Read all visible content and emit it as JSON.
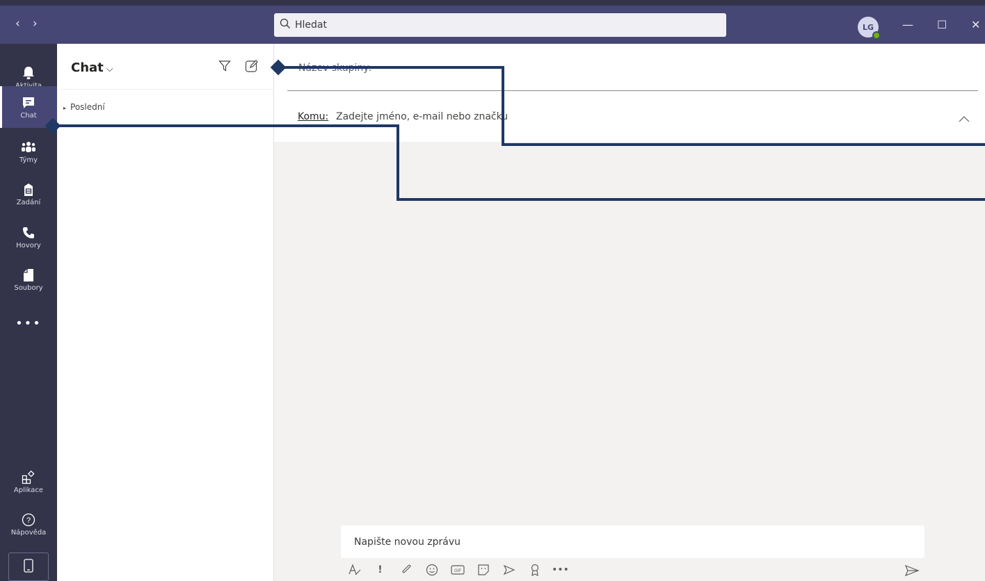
{
  "titlebar": {
    "back_glyph": "‹",
    "forward_glyph": "›",
    "search_placeholder": "Hledat",
    "avatar_initials": "LG",
    "minimize_glyph": "—",
    "maximize_glyph": "☐",
    "close_glyph": "✕"
  },
  "rail": {
    "items": [
      {
        "label": "Aktivita",
        "icon": "bell-icon"
      },
      {
        "label": "Chat",
        "icon": "chat-icon"
      },
      {
        "label": "Týmy",
        "icon": "teams-icon"
      },
      {
        "label": "Zadání",
        "icon": "assignments-icon"
      },
      {
        "label": "Hovory",
        "icon": "phone-icon"
      },
      {
        "label": "Soubory",
        "icon": "file-icon"
      }
    ],
    "more": "•••",
    "apps_label": "Aplikace",
    "help_label": "Nápověda"
  },
  "chatlist": {
    "title": "Chat",
    "title_chevron": "⌵",
    "section": "Poslední",
    "section_glyph": "▸"
  },
  "newchat": {
    "group_name_placeholder": "Název skupiny:",
    "to_label": "Komu:",
    "to_placeholder": "Zadejte jméno, e-mail nebo značku"
  },
  "compose": {
    "placeholder": "Napište novou zprávu",
    "toolbar": [
      "format-icon",
      "important-icon",
      "attach-icon",
      "emoji-icon",
      "gif-icon",
      "sticker-icon",
      "meet-icon",
      "praise-icon",
      "more-icon"
    ],
    "important_glyph": "!",
    "more_glyph": "•••"
  },
  "colors": {
    "titlebar": "#464775",
    "rail": "#33344a",
    "callout": "#1f3864"
  }
}
